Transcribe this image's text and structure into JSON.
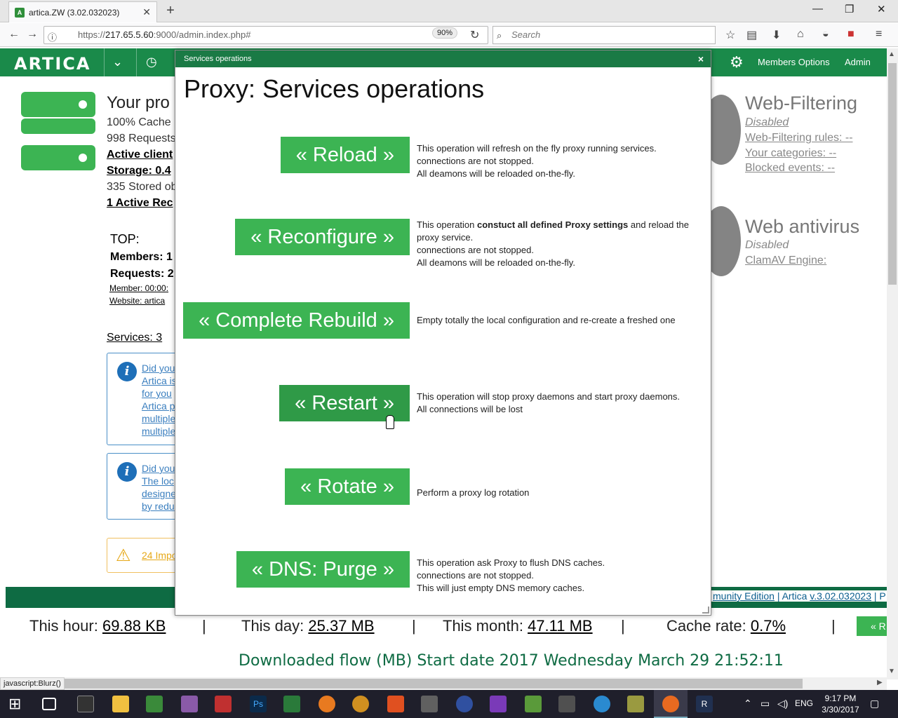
{
  "browser": {
    "tab_title": "artica.ZW (3.02.032023)",
    "tab_close": "✕",
    "new_tab": "+",
    "url_prefix": "https://",
    "url_host": "217.65.5.60",
    "url_rest": ":9000/admin.index.php#",
    "zoom": "90%",
    "search_placeholder": "Search",
    "status_text": "javascript:Blurz()"
  },
  "app": {
    "logo": "ARTICA",
    "members_options": "Members Options",
    "admin": "Admin"
  },
  "left": {
    "title": "Your pro",
    "cache": "100% Cache",
    "requests": "998 Requests",
    "active_clients": "Active client",
    "storage": "Storage: 0.4",
    "stored": "335 Stored ob",
    "active_req": "1 Active Rec",
    "top": "TOP:",
    "members": "Members: 1",
    "requests2": "Requests: 2",
    "member_time": "Member: 00:00:",
    "website": "Website: artica",
    "services": "Services: 3",
    "info1": [
      "Did you",
      "Artica is",
      "for you",
      "Artica p",
      "multiple",
      "multiple"
    ],
    "info2": [
      "Did you",
      "The loc",
      "designe",
      "by redu"
    ],
    "warning": "24 Impo"
  },
  "right": {
    "wf_title": "Web-Filtering",
    "wf_status": "Disabled",
    "wf_rules": "Web-Filtering rules: --",
    "wf_categories": "Your categories: --",
    "wf_blocked": "Blocked events: --",
    "av_title": "Web antivirus",
    "av_status": "Disabled",
    "av_engine": "ClamAV Engine:"
  },
  "footer": {
    "links_prefix": "munity Edition",
    "sep": "|",
    "artica": "Artica",
    "version": "v.3.02.032023",
    "tail": "| P"
  },
  "stats": {
    "hour_label": "This hour:",
    "hour_value": "69.88 KB",
    "day_label": "This day:",
    "day_value": "25.37 MB",
    "month_label": "This month:",
    "month_value": "47.11 MB",
    "cache_label": "Cache rate:",
    "cache_value": "0.7%",
    "pipe": "|",
    "r_button": "« R",
    "download_flow": "Downloaded flow (MB) Start date 2017 Wednesday March 29 21:52:11"
  },
  "modal": {
    "header": "Services operations",
    "close": "×",
    "title": "Proxy: Services operations",
    "ops": [
      {
        "label": "« Reload »",
        "desc": [
          "This operation will refresh on the fly proxy running services.",
          "connections are not stopped.",
          "All deamons will be reloaded on-the-fly."
        ]
      },
      {
        "label": "« Reconfigure »",
        "desc_pre": "This operation ",
        "desc_bold": "constuct all defined Proxy settings",
        "desc_post": " and reload the proxy service.",
        "desc": [
          "connections are not stopped.",
          "All deamons will be reloaded on-the-fly."
        ]
      },
      {
        "label": "« Complete Rebuild »",
        "desc": [
          "Empty totally the local configuration and re-create a freshed one"
        ]
      },
      {
        "label": "« Restart »",
        "desc": [
          "This operation will stop proxy daemons and start proxy daemons.",
          "All connections will be lost"
        ]
      },
      {
        "label": "« Rotate »",
        "desc": [
          "Perform a proxy log rotation"
        ]
      },
      {
        "label": "« DNS: Purge »",
        "desc": [
          "This operation ask Proxy to flush DNS caches.",
          "connections are not stopped.",
          "This will just empty DNS memory caches."
        ]
      }
    ]
  },
  "taskbar": {
    "lang": "ENG",
    "time": "9:17 PM",
    "date": "3/30/2017"
  }
}
